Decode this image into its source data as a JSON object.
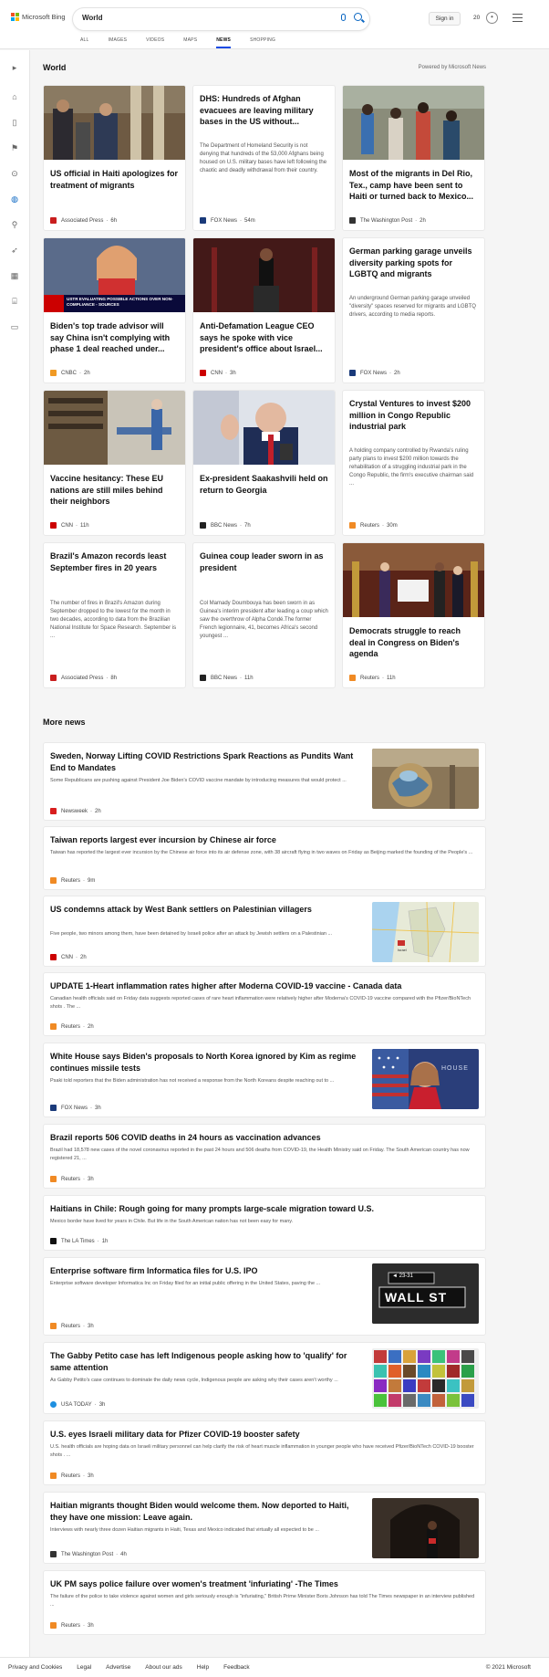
{
  "header": {
    "brand": "Microsoft Bing",
    "search_query": "World",
    "sign_in": "Sign in",
    "points": "20",
    "tabs": [
      {
        "label": "ALL",
        "active": false
      },
      {
        "label": "IMAGES",
        "active": false
      },
      {
        "label": "VIDEOS",
        "active": false
      },
      {
        "label": "MAPS",
        "active": false
      },
      {
        "label": "NEWS",
        "active": true
      },
      {
        "label": "SHOPPING",
        "active": false
      }
    ]
  },
  "colors": {
    "accent": "#174ae4",
    "brand_blue": "#0a66c2"
  },
  "main": {
    "section_title": "World",
    "powered_by": "Powered by Microsoft News",
    "top_cards": [
      {
        "title": "US official in Haiti apologizes for treatment of migrants",
        "snippet": "",
        "source": "Associated Press",
        "time": "6h",
        "logo_color": "#c91e1e",
        "icon": "ap-logo-icon"
      },
      {
        "title": "DHS: Hundreds of Afghan evacuees are leaving military bases in the US without...",
        "snippet": "The Department of Homeland Security is not denying that hundreds of the 53,000 Afghans being housed on U.S. military bases have left following the chaotic and deadly withdrawal from their country.",
        "source": "FOX News",
        "time": "54m",
        "logo_color": "#1a3a7a",
        "icon": "fox-logo-icon"
      },
      {
        "title": "Most of the migrants in Del Rio, Tex., camp have been sent to Haiti or turned back to Mexico...",
        "snippet": "",
        "source": "The Washington Post",
        "time": "2h",
        "logo_color": "#333333",
        "icon": "wapo-logo-icon"
      },
      {
        "title": "Biden's top trade advisor will say China isn't complying with phase 1 deal reached under...",
        "snippet": "",
        "source": "CNBC",
        "time": "2h",
        "logo_color": "#f09a24",
        "icon": "cnbc-logo-icon"
      },
      {
        "title": "Anti-Defamation League CEO says he spoke with vice president's office about Israel...",
        "snippet": "",
        "source": "CNN",
        "time": "3h",
        "logo_color": "#cc0000",
        "icon": "cnn-logo-icon"
      },
      {
        "title": "German parking garage unveils diversity parking spots for LGBTQ and migrants",
        "snippet": "An underground German parking garage unveiled \"diversity\" spaces reserved for migrants and LGBTQ drivers, according to media reports.",
        "source": "FOX News",
        "time": "2h",
        "logo_color": "#1a3a7a",
        "icon": "fox-logo-icon"
      },
      {
        "title": "Vaccine hesitancy: These EU nations are still miles behind their neighbors",
        "snippet": "",
        "source": "CNN",
        "time": "11h",
        "logo_color": "#cc0000",
        "icon": "cnn-logo-icon"
      },
      {
        "title": "Ex-president Saakashvili held on return to Georgia",
        "snippet": "",
        "source": "BBC News",
        "time": "7h",
        "logo_color": "#222222",
        "icon": "bbc-logo-icon"
      },
      {
        "title": "Crystal Ventures to invest $200 million in Congo Republic industrial park",
        "snippet": "A holding company controlled by Rwanda's ruling party plans to invest $200 million towards the rehabilitation of a struggling industrial park in the Congo Republic, the firm's executive chairman said ...",
        "source": "Reuters",
        "time": "30m",
        "logo_color": "#f08a24",
        "icon": "reuters-logo-icon"
      },
      {
        "title": "Brazil's Amazon records least September fires in 20 years",
        "snippet": "The number of fires in Brazil's Amazon during September dropped to the lowest for the month in two decades, according to data from the Brazilian National Institute for Space Research. September is ...",
        "source": "Associated Press",
        "time": "8h",
        "logo_color": "#c91e1e",
        "icon": "ap-logo-icon"
      },
      {
        "title": "Guinea coup leader sworn in as president",
        "snippet": "Col Mamady Doumbouya has been sworn in as Guinea's interim president after leading a coup which saw the overthrow of Alpha Condé.The former French legionnaire, 41, becomes Africa's second youngest ...",
        "source": "BBC News",
        "time": "11h",
        "logo_color": "#222222",
        "icon": "bbc-logo-icon"
      },
      {
        "title": "Democrats struggle to reach deal in Congress on Biden's agenda",
        "snippet": "",
        "source": "Reuters",
        "time": "11h",
        "logo_color": "#f08a24",
        "icon": "reuters-logo-icon"
      }
    ],
    "image_overlay_text": "USTR EVALUATING POSSIBLE ACTIONS OVER NON-COMPLIANCE - SOURCES",
    "thumb_wall_text": "WALL ST",
    "thumb_wall_sub": "◄ 23-31",
    "thumb_house_text": "HOUSE",
    "thumb_map_label": "Israel",
    "more_title": "More news",
    "more_news": [
      {
        "title": "Sweden, Norway Lifting COVID Restrictions Spark Reactions as Pundits Want End to Mandates",
        "snippet": "Some Republicans are pushing against President Joe Biden's COVID vaccine mandate by introducing measures that would protect ...",
        "source": "Newsweek",
        "time": "2h",
        "logo_color": "#d81e1e",
        "icon": "newsweek-logo-icon"
      },
      {
        "title": "Taiwan reports largest ever incursion by Chinese air force",
        "snippet": "Taiwan has reported the largest ever incursion by the Chinese air force into its air defense zone, with 38 aircraft flying in two waves on Friday as Beijing marked the founding of the People's ...",
        "source": "Reuters",
        "time": "9m",
        "logo_color": "#f08a24",
        "icon": "reuters-logo-icon"
      },
      {
        "title": "US condemns attack by West Bank settlers on Palestinian villagers",
        "snippet": "Five people, two minors among them, have been detained by Israeli police after an attack by Jewish settlers on a Palestinian ...",
        "source": "CNN",
        "time": "2h",
        "logo_color": "#cc0000",
        "icon": "cnn-logo-icon"
      },
      {
        "title": "UPDATE 1-Heart inflammation rates higher after Moderna COVID-19 vaccine - Canada data",
        "snippet": "Canadian health officials said on Friday data suggests reported cases of rare heart inflammation were relatively higher after Moderna's COVID-19 vaccine compared with the Pfizer/BioNTech shots . The ...",
        "source": "Reuters",
        "time": "2h",
        "logo_color": "#f08a24",
        "icon": "reuters-logo-icon"
      },
      {
        "title": "White House says Biden's proposals to North Korea ignored by Kim as regime continues missile tests",
        "snippet": "Psaki told reporters that the Biden administration has not received a response from the North Koreans despite reaching out to ...",
        "source": "FOX News",
        "time": "3h",
        "logo_color": "#1a3a7a",
        "icon": "fox-logo-icon"
      },
      {
        "title": "Brazil reports 506 COVID deaths in 24 hours as vaccination advances",
        "snippet": "Brazil had 18,578 new cases of the novel coronavirus reported in the past 24 hours and 506 deaths from COVID-19, the Health Ministry said on Friday. The South American country has now registered 21, ...",
        "source": "Reuters",
        "time": "3h",
        "logo_color": "#f08a24",
        "icon": "reuters-logo-icon"
      },
      {
        "title": "Haitians in Chile: Rough going for many prompts large-scale migration toward U.S.",
        "snippet": "Mexico border have lived for years in Chile. But life in the South American nation has not been easy for many.",
        "source": "The LA Times",
        "time": "1h",
        "logo_color": "#111111",
        "icon": "latimes-logo-icon"
      },
      {
        "title": "Enterprise software firm Informatica files for U.S. IPO",
        "snippet": "Enterprise software developer Informatica Inc on Friday filed for an initial public offering in the United States, paving the ...",
        "source": "Reuters",
        "time": "3h",
        "logo_color": "#f08a24",
        "icon": "reuters-logo-icon"
      },
      {
        "title": "The Gabby Petito case has left Indigenous people asking how to 'qualify' for same attention",
        "snippet": "As Gabby Petito's case continues to dominate the daily news cycle, Indigenous people are asking why their cases aren't worthy ...",
        "source": "USA TODAY",
        "time": "3h",
        "logo_color": "#1e8fe0",
        "icon": "usatoday-logo-icon"
      },
      {
        "title": "U.S. eyes Israeli military data for Pfizer COVID-19 booster safety",
        "snippet": "U.S. health officials are hoping data on Israeli military personnel can help clarify the risk of heart muscle inflammation in younger people who have received Pfizer/BioNTech COVID-19 booster shots . ...",
        "source": "Reuters",
        "time": "3h",
        "logo_color": "#f08a24",
        "icon": "reuters-logo-icon"
      },
      {
        "title": "Haitian migrants thought Biden would welcome them. Now deported to Haiti, they have one mission: Leave again.",
        "snippet": "Interviews with nearly three dozen Haitian migrants in Haiti, Texas and Mexico indicated that virtually all expected to be ...",
        "source": "The Washington Post",
        "time": "4h",
        "logo_color": "#333333",
        "icon": "wapo-logo-icon"
      },
      {
        "title": "UK PM says police failure over women's treatment 'infuriating' -The Times",
        "snippet": "The failure of the police to take violence against women and girls seriously enough is \"infuriating,\" British Prime Minister Boris Johnson has told The Times newspaper in an interview published ...",
        "source": "Reuters",
        "time": "3h",
        "logo_color": "#f08a24",
        "icon": "reuters-logo-icon"
      }
    ]
  },
  "rail": {
    "icons": [
      "chevron-right-icon",
      "home-icon",
      "bookmark-icon",
      "flag-icon",
      "location-icon",
      "globe-icon",
      "microscope-icon",
      "rocket-icon",
      "grid-icon",
      "bank-icon",
      "card-icon"
    ]
  },
  "footer": {
    "links": [
      "Privacy and Cookies",
      "Legal",
      "Advertise",
      "About our ads",
      "Help",
      "Feedback"
    ],
    "copyright": "© 2021 Microsoft"
  }
}
